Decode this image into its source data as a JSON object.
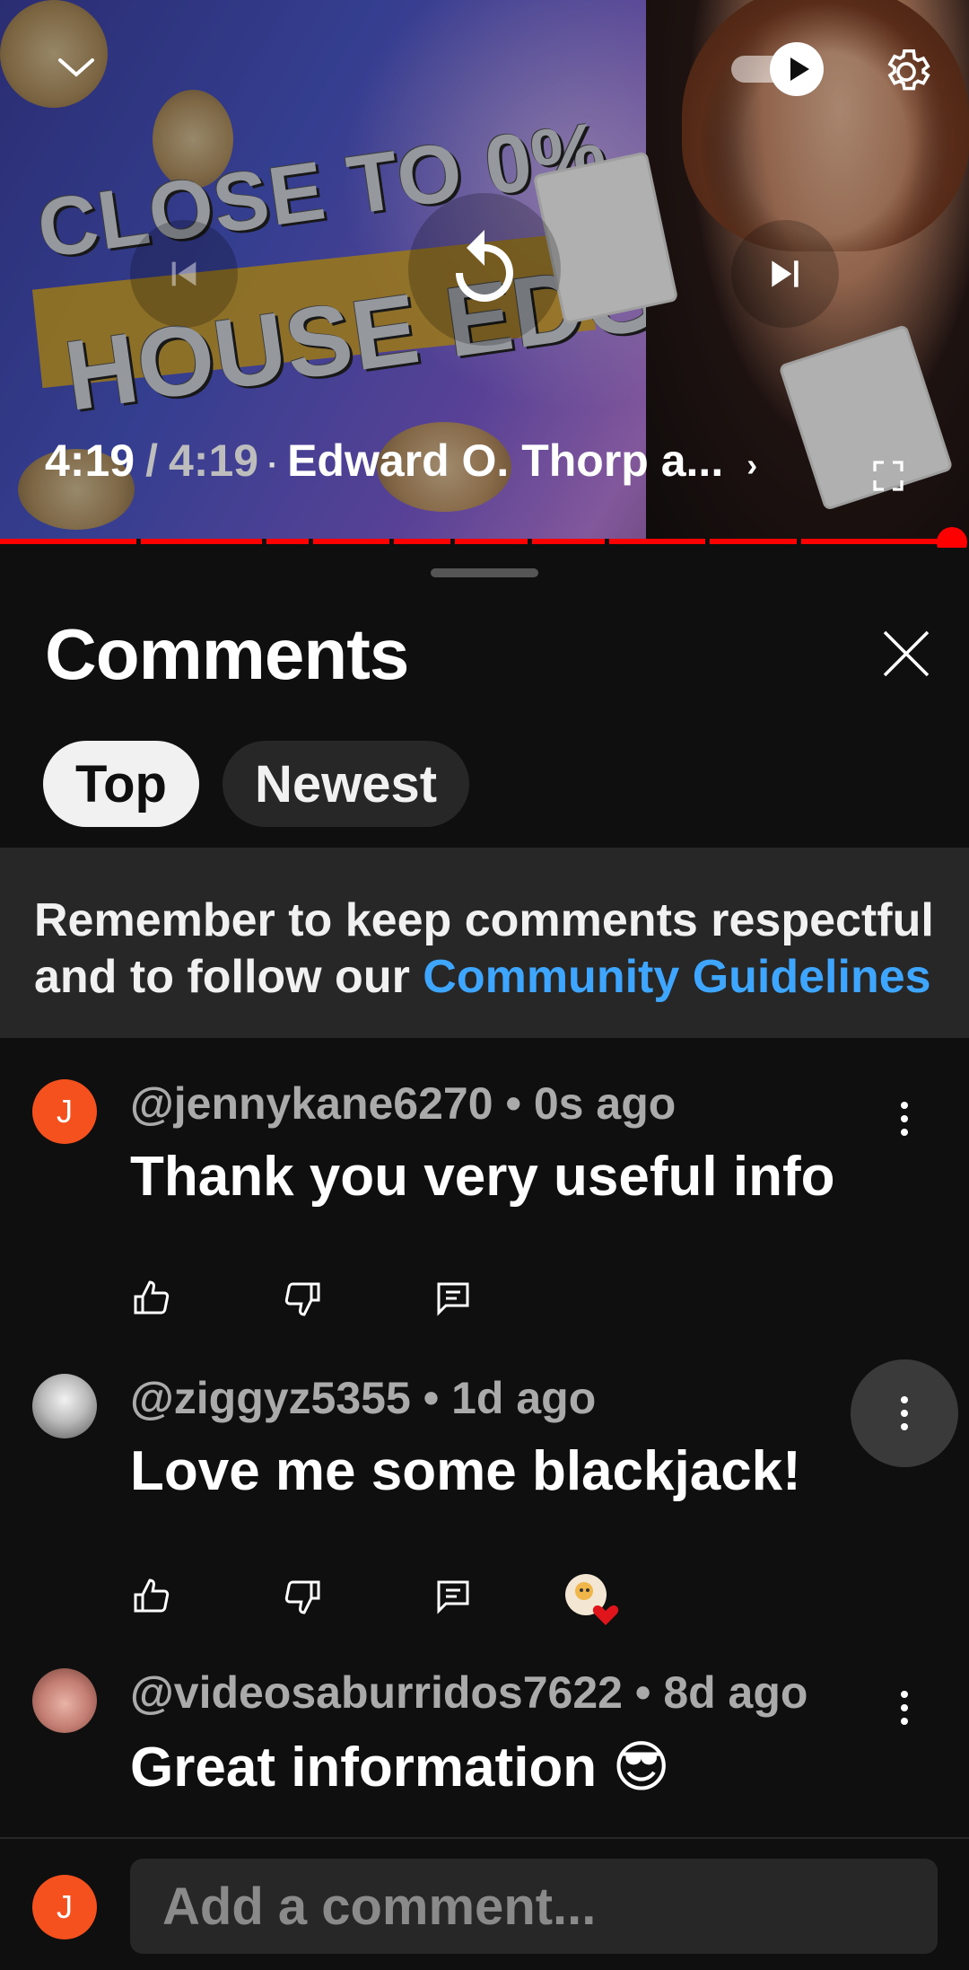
{
  "player": {
    "thumbnail": {
      "line1": "CLOSE TO 0%",
      "line2": "HOUSE EDGE?"
    },
    "time_current": "4:19",
    "time_separator": "/",
    "time_duration": "4:19",
    "dot": "·",
    "video_title": "Edward O. Thorp a...",
    "chevron": "›",
    "progress_fraction": 1.0,
    "autoplay_on": true,
    "icons": {
      "collapse": "chevron-down-icon",
      "autoplay": "autoplay-toggle-icon",
      "settings": "gear-icon",
      "previous": "skip-previous-icon",
      "replay": "replay-icon",
      "next": "skip-next-icon",
      "fullscreen": "fullscreen-icon"
    }
  },
  "comments_panel": {
    "title": "Comments",
    "close_icon": "close-icon",
    "sort_chips": [
      {
        "label": "Top",
        "active": true
      },
      {
        "label": "Newest",
        "active": false
      }
    ],
    "notice": {
      "text": "Remember to keep comments respectful and to follow our ",
      "link": "Community Guidelines"
    },
    "comments": [
      {
        "avatar_letter": "J",
        "author": "@jennykane6270",
        "dot": "•",
        "time": "0s ago",
        "text": "Thank you very useful info",
        "creator_heart": false
      },
      {
        "avatar_letter": "",
        "author": "@ziggyz5355",
        "dot": "•",
        "time": "1d ago",
        "text": "Love me some blackjack!",
        "creator_heart": true
      },
      {
        "avatar_letter": "",
        "author": "@videosaburridos7622",
        "dot": "•",
        "time": "8d ago",
        "text": "Great information 😎",
        "creator_heart": false
      }
    ]
  },
  "composer": {
    "avatar_letter": "J",
    "placeholder": "Add a comment..."
  },
  "colors": {
    "background": "#0f0f0f",
    "surface": "#272727",
    "progress": "#ff0000",
    "link": "#3ea6ff",
    "avatar_orange": "#f4511e"
  }
}
